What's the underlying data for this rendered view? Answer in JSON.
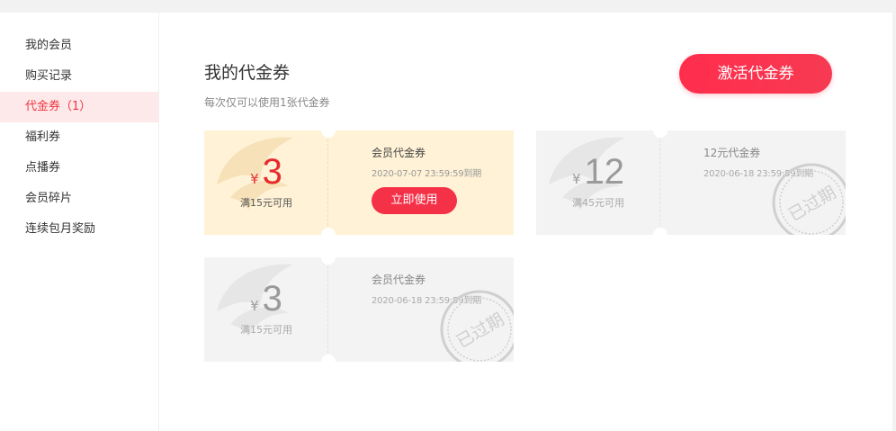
{
  "sidebar": {
    "items": [
      {
        "label": "我的会员"
      },
      {
        "label": "购买记录"
      },
      {
        "label": "代金券（1）"
      },
      {
        "label": "福利券"
      },
      {
        "label": "点播券"
      },
      {
        "label": "会员碎片"
      },
      {
        "label": "连续包月奖励"
      }
    ]
  },
  "main": {
    "title": "我的代金券",
    "subtitle": "每次仅可以使用1张代金券",
    "activate_label": "激活代金券"
  },
  "coupons": [
    {
      "currency": "¥",
      "amount": "3",
      "condition": "满15元可用",
      "name": "会员代金券",
      "expiry": "2020-07-07 23:59:59到期",
      "action_label": "立即使用",
      "status": "active"
    },
    {
      "currency": "¥",
      "amount": "12",
      "condition": "满45元可用",
      "name": "12元代金券",
      "expiry": "2020-06-18 23:59:59到期",
      "stamp": "已过期",
      "status": "expired"
    },
    {
      "currency": "¥",
      "amount": "3",
      "condition": "满15元可用",
      "name": "会员代金券",
      "expiry": "2020-06-18 23:59:59到期",
      "stamp": "已过期",
      "status": "expired"
    }
  ],
  "colors": {
    "accent": "#f0343f",
    "active_coupon_bg": "#fff2d6",
    "expired_coupon_bg": "#f3f3f3"
  }
}
